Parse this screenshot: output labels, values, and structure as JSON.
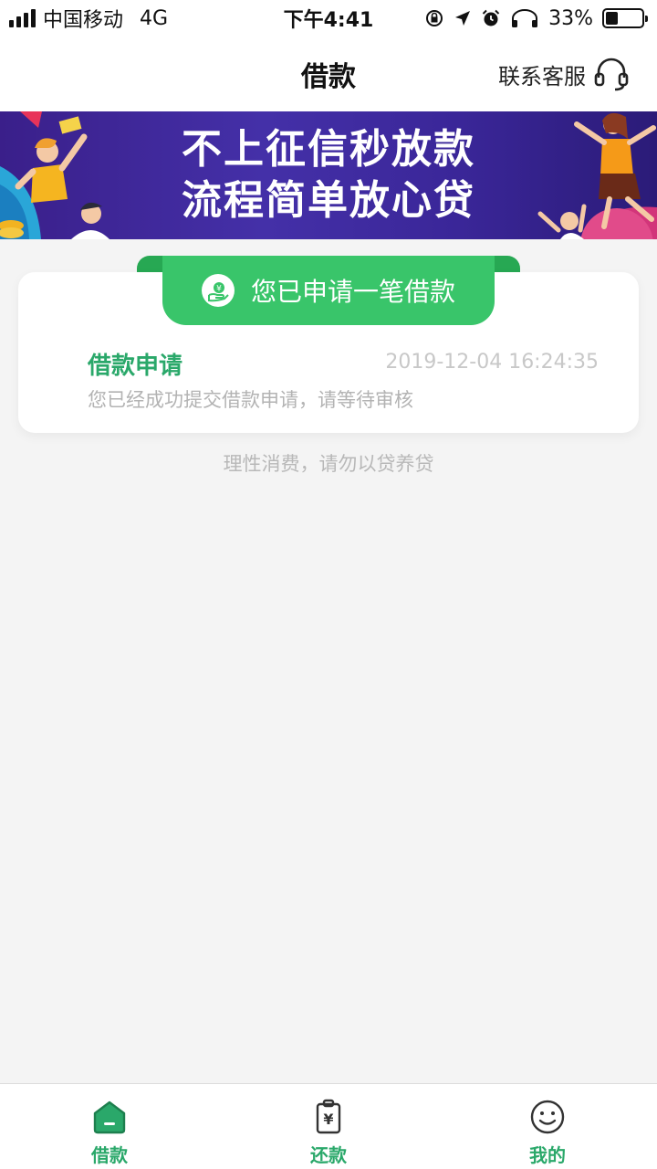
{
  "status_bar": {
    "carrier": "中国移动",
    "network": "4G",
    "time": "下午4:41",
    "battery": "33%"
  },
  "header": {
    "title": "借款",
    "service_label": "联系客服"
  },
  "banner": {
    "line1": "不上征信秒放款",
    "line2": "流程简单放心贷"
  },
  "card": {
    "badge_text": "您已申请一笔借款",
    "title": "借款申请",
    "time": "2019-12-04 16:24:35",
    "description": "您已经成功提交借款申请，请等待审核"
  },
  "note": "理性消费，请勿以贷养贷",
  "tabbar": {
    "tabs": [
      {
        "label": "借款",
        "icon": "house-icon"
      },
      {
        "label": "还款",
        "icon": "repay-card-icon"
      },
      {
        "label": "我的",
        "icon": "smiley-icon"
      }
    ]
  },
  "colors": {
    "accent": "#2aa86a",
    "badge": "#39c56a",
    "banner": "#4430a8"
  }
}
